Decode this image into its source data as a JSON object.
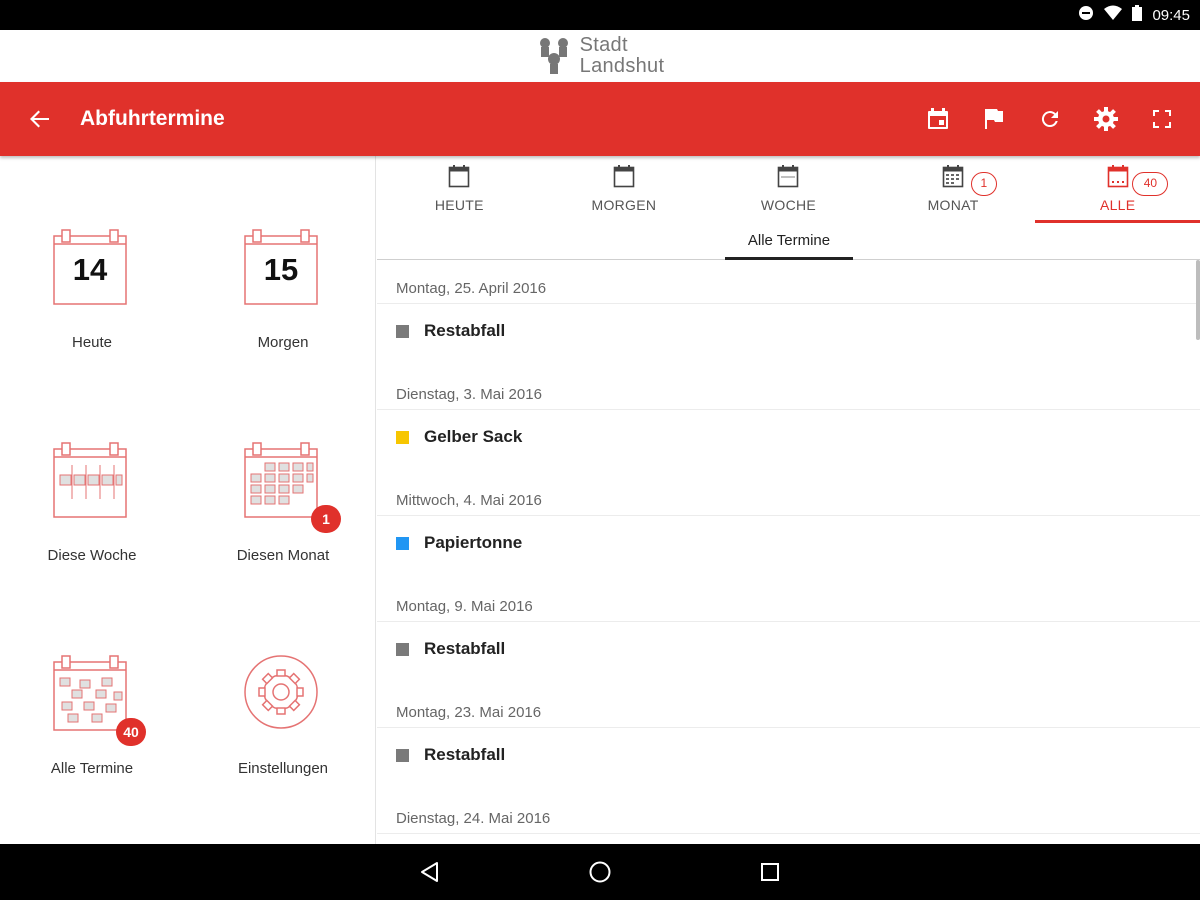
{
  "status_bar": {
    "time": "09:45",
    "icons": [
      "dnd-icon",
      "wifi-icon",
      "battery-icon"
    ]
  },
  "logo": {
    "line1": "Stadt",
    "line2": "Landshut"
  },
  "toolbar": {
    "title": "Abfuhrtermine",
    "actions": [
      "calendar-today-icon",
      "flag-icon",
      "refresh-icon",
      "settings-icon",
      "fullscreen-icon"
    ]
  },
  "tiles": [
    {
      "label": "Heute",
      "number": "14"
    },
    {
      "label": "Morgen",
      "number": "15"
    },
    {
      "label": "Diese Woche"
    },
    {
      "label": "Diesen Monat",
      "badge": "1"
    },
    {
      "label": "Alle Termine",
      "badge": "40"
    },
    {
      "label": "Einstellungen"
    }
  ],
  "tabs": [
    {
      "label": "HEUTE"
    },
    {
      "label": "MORGEN"
    },
    {
      "label": "WOCHE"
    },
    {
      "label": "MONAT",
      "badge": "1"
    },
    {
      "label": "ALLE",
      "badge": "40",
      "active": true
    }
  ],
  "subtab": {
    "label": "Alle Termine"
  },
  "events": [
    {
      "date": "Montag, 25. April 2016",
      "name": "Restabfall",
      "color": "#7a7a7a"
    },
    {
      "date": "Dienstag, 3. Mai 2016",
      "name": "Gelber Sack",
      "color": "#f7c600"
    },
    {
      "date": "Mittwoch, 4. Mai 2016",
      "name": "Papiertonne",
      "color": "#2196f3"
    },
    {
      "date": "Montag, 9. Mai 2016",
      "name": "Restabfall",
      "color": "#7a7a7a"
    },
    {
      "date": "Montag, 23. Mai 2016",
      "name": "Restabfall",
      "color": "#7a7a7a"
    },
    {
      "date": "Dienstag, 24. Mai 2016"
    }
  ],
  "colors": {
    "accent": "#e0312b"
  }
}
